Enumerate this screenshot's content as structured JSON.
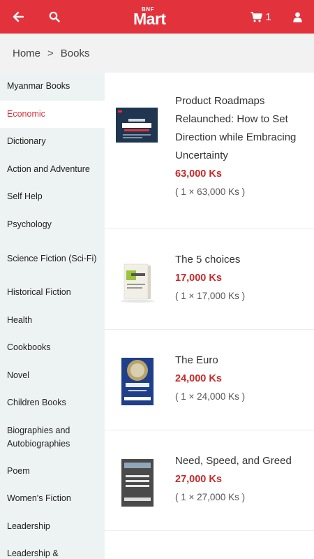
{
  "header": {
    "logo_small": "BNF",
    "logo_main": "Mart",
    "cart_count": "1",
    "brand_color": "#e2333d"
  },
  "breadcrumb": {
    "home": "Home",
    "separator": ">",
    "current": "Books"
  },
  "sidebar": {
    "items": [
      {
        "label": "Myanmar Books"
      },
      {
        "label": "Economic"
      },
      {
        "label": "Dictionary"
      },
      {
        "label": "Action and Adventure"
      },
      {
        "label": "Self Help"
      },
      {
        "label": "Psychology"
      },
      {
        "label": "Science Fiction (Sci-Fi)"
      },
      {
        "label": "Historical Fiction"
      },
      {
        "label": "Health"
      },
      {
        "label": "Cookbooks"
      },
      {
        "label": "Novel"
      },
      {
        "label": "Children Books"
      },
      {
        "label": "Biographies and Autobiographies"
      },
      {
        "label": "Poem"
      },
      {
        "label": "Women's Fiction"
      },
      {
        "label": "Leadership"
      },
      {
        "label": "Leadership &"
      }
    ],
    "active_index": 1
  },
  "products": [
    {
      "title": "Product Roadmaps Relaunched: How to Set Direction while Embracing Uncertainty",
      "price": "63,000 Ks",
      "qty": "( 1 × 63,000 Ks )"
    },
    {
      "title": "The 5 choices",
      "price": "17,000 Ks",
      "qty": "( 1 × 17,000 Ks )"
    },
    {
      "title": "The Euro",
      "price": "24,000 Ks",
      "qty": "( 1 × 24,000 Ks )"
    },
    {
      "title": "Need, Speed, and Greed",
      "price": "27,000 Ks",
      "qty": "( 1 × 27,000 Ks )"
    }
  ]
}
